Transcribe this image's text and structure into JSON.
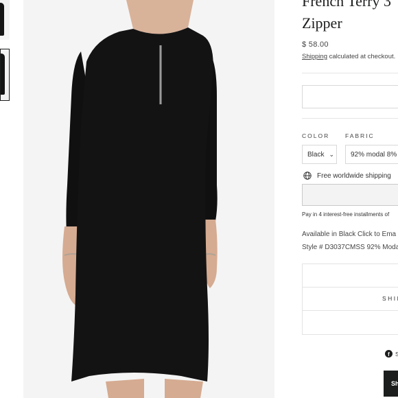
{
  "product": {
    "title_line1": "French Terry 3",
    "title_line2": "Zipper",
    "price": "$ 58.00",
    "shipping_link": "Shipping",
    "shipping_rest": " calculated at checkout."
  },
  "options": {
    "color_label": "COLOR",
    "color_value": "Black",
    "fabric_label": "FABRIC",
    "fabric_value": "92% modal 8% s"
  },
  "shipping_badge": "Free worldwide shipping",
  "installments": "Pay in 4 interest-free installments of",
  "description": {
    "line1": "Available in Black Click to Ema",
    "line2": "Style # D3037CMSS 92% Modal"
  },
  "accordion": {
    "item2": "SHIP"
  },
  "share": {
    "label": "S"
  },
  "dark_button_label": "Sh",
  "icons": {
    "globe": "globe-icon",
    "chevron": "chevron-down-icon",
    "facebook": "facebook-icon"
  },
  "colors": {
    "text": "#1c1d1d",
    "border": "#d8d8d8",
    "background": "#ffffff"
  }
}
